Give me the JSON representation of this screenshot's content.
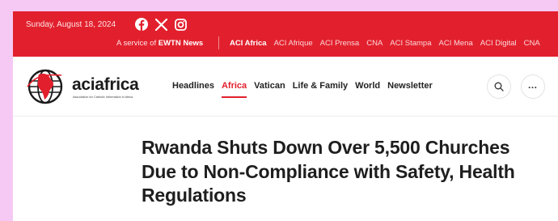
{
  "topbar": {
    "date": "Sunday, August 18, 2024",
    "social_icons": [
      "facebook-icon",
      "x-icon",
      "instagram-icon"
    ],
    "service_prefix": "A service of ",
    "service_brand": "EWTN News",
    "network": [
      {
        "label": "ACI Africa",
        "active": true
      },
      {
        "label": "ACI Afrique",
        "active": false
      },
      {
        "label": "ACI Prensa",
        "active": false
      },
      {
        "label": "CNA",
        "active": false
      },
      {
        "label": "ACI Stampa",
        "active": false
      },
      {
        "label": "ACI Mena",
        "active": false
      },
      {
        "label": "ACI Digital",
        "active": false
      },
      {
        "label": "CNA",
        "active": false
      }
    ]
  },
  "header": {
    "logo_text": "aciafrica",
    "logo_tagline": "Association for Catholic Information in Africa",
    "nav": [
      {
        "label": "Headlines",
        "active": false
      },
      {
        "label": "Africa",
        "active": true
      },
      {
        "label": "Vatican",
        "active": false
      },
      {
        "label": "Life & Family",
        "active": false
      },
      {
        "label": "World",
        "active": false
      },
      {
        "label": "Newsletter",
        "active": false
      }
    ],
    "search_icon": "search-icon",
    "more_icon": "more-icon",
    "more_glyph": "…"
  },
  "article": {
    "title": "Rwanda Shuts Down Over 5,500 Churches Due to Non-Compliance with Safety, Health Regulations"
  },
  "colors": {
    "brand_red": "#e2202d",
    "page_background": "#f6c9f4",
    "text_dark": "#1e1e1e"
  }
}
